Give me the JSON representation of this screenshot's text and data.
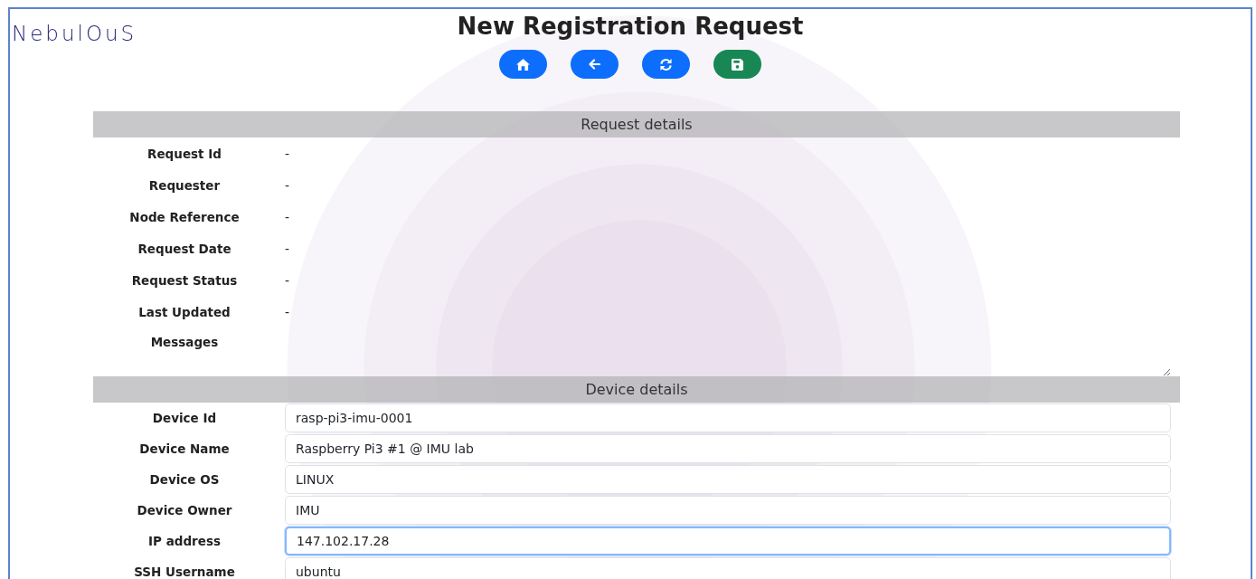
{
  "brand": "NebulOuS",
  "title": "New Registration Request",
  "sections": [
    {
      "title": "Request details",
      "rows": [
        {
          "kind": "text",
          "label": "Request Id",
          "value": "-"
        },
        {
          "kind": "text",
          "label": "Requester",
          "value": "-"
        },
        {
          "kind": "text",
          "label": "Node Reference",
          "value": "-"
        },
        {
          "kind": "text",
          "label": "Request Date",
          "value": "-"
        },
        {
          "kind": "text",
          "label": "Request Status",
          "value": "-"
        },
        {
          "kind": "text",
          "label": "Last Updated",
          "value": "-"
        },
        {
          "kind": "textarea",
          "label": "Messages"
        }
      ]
    },
    {
      "title": "Device details",
      "rows": [
        {
          "kind": "input",
          "label": "Device Id",
          "value": "rasp-pi3-imu-0001",
          "focused": false
        },
        {
          "kind": "input",
          "label": "Device Name",
          "value": "Raspberry Pi3 #1 @ IMU lab",
          "focused": false
        },
        {
          "kind": "input",
          "label": "Device OS",
          "value": "LINUX",
          "focused": false
        },
        {
          "kind": "input",
          "label": "Device Owner",
          "value": "IMU",
          "focused": false
        },
        {
          "kind": "input",
          "label": "IP address",
          "value": "147.102.17.28",
          "focused": true
        },
        {
          "kind": "input",
          "label": "SSH Username",
          "value": "ubuntu",
          "focused": false
        }
      ]
    }
  ]
}
